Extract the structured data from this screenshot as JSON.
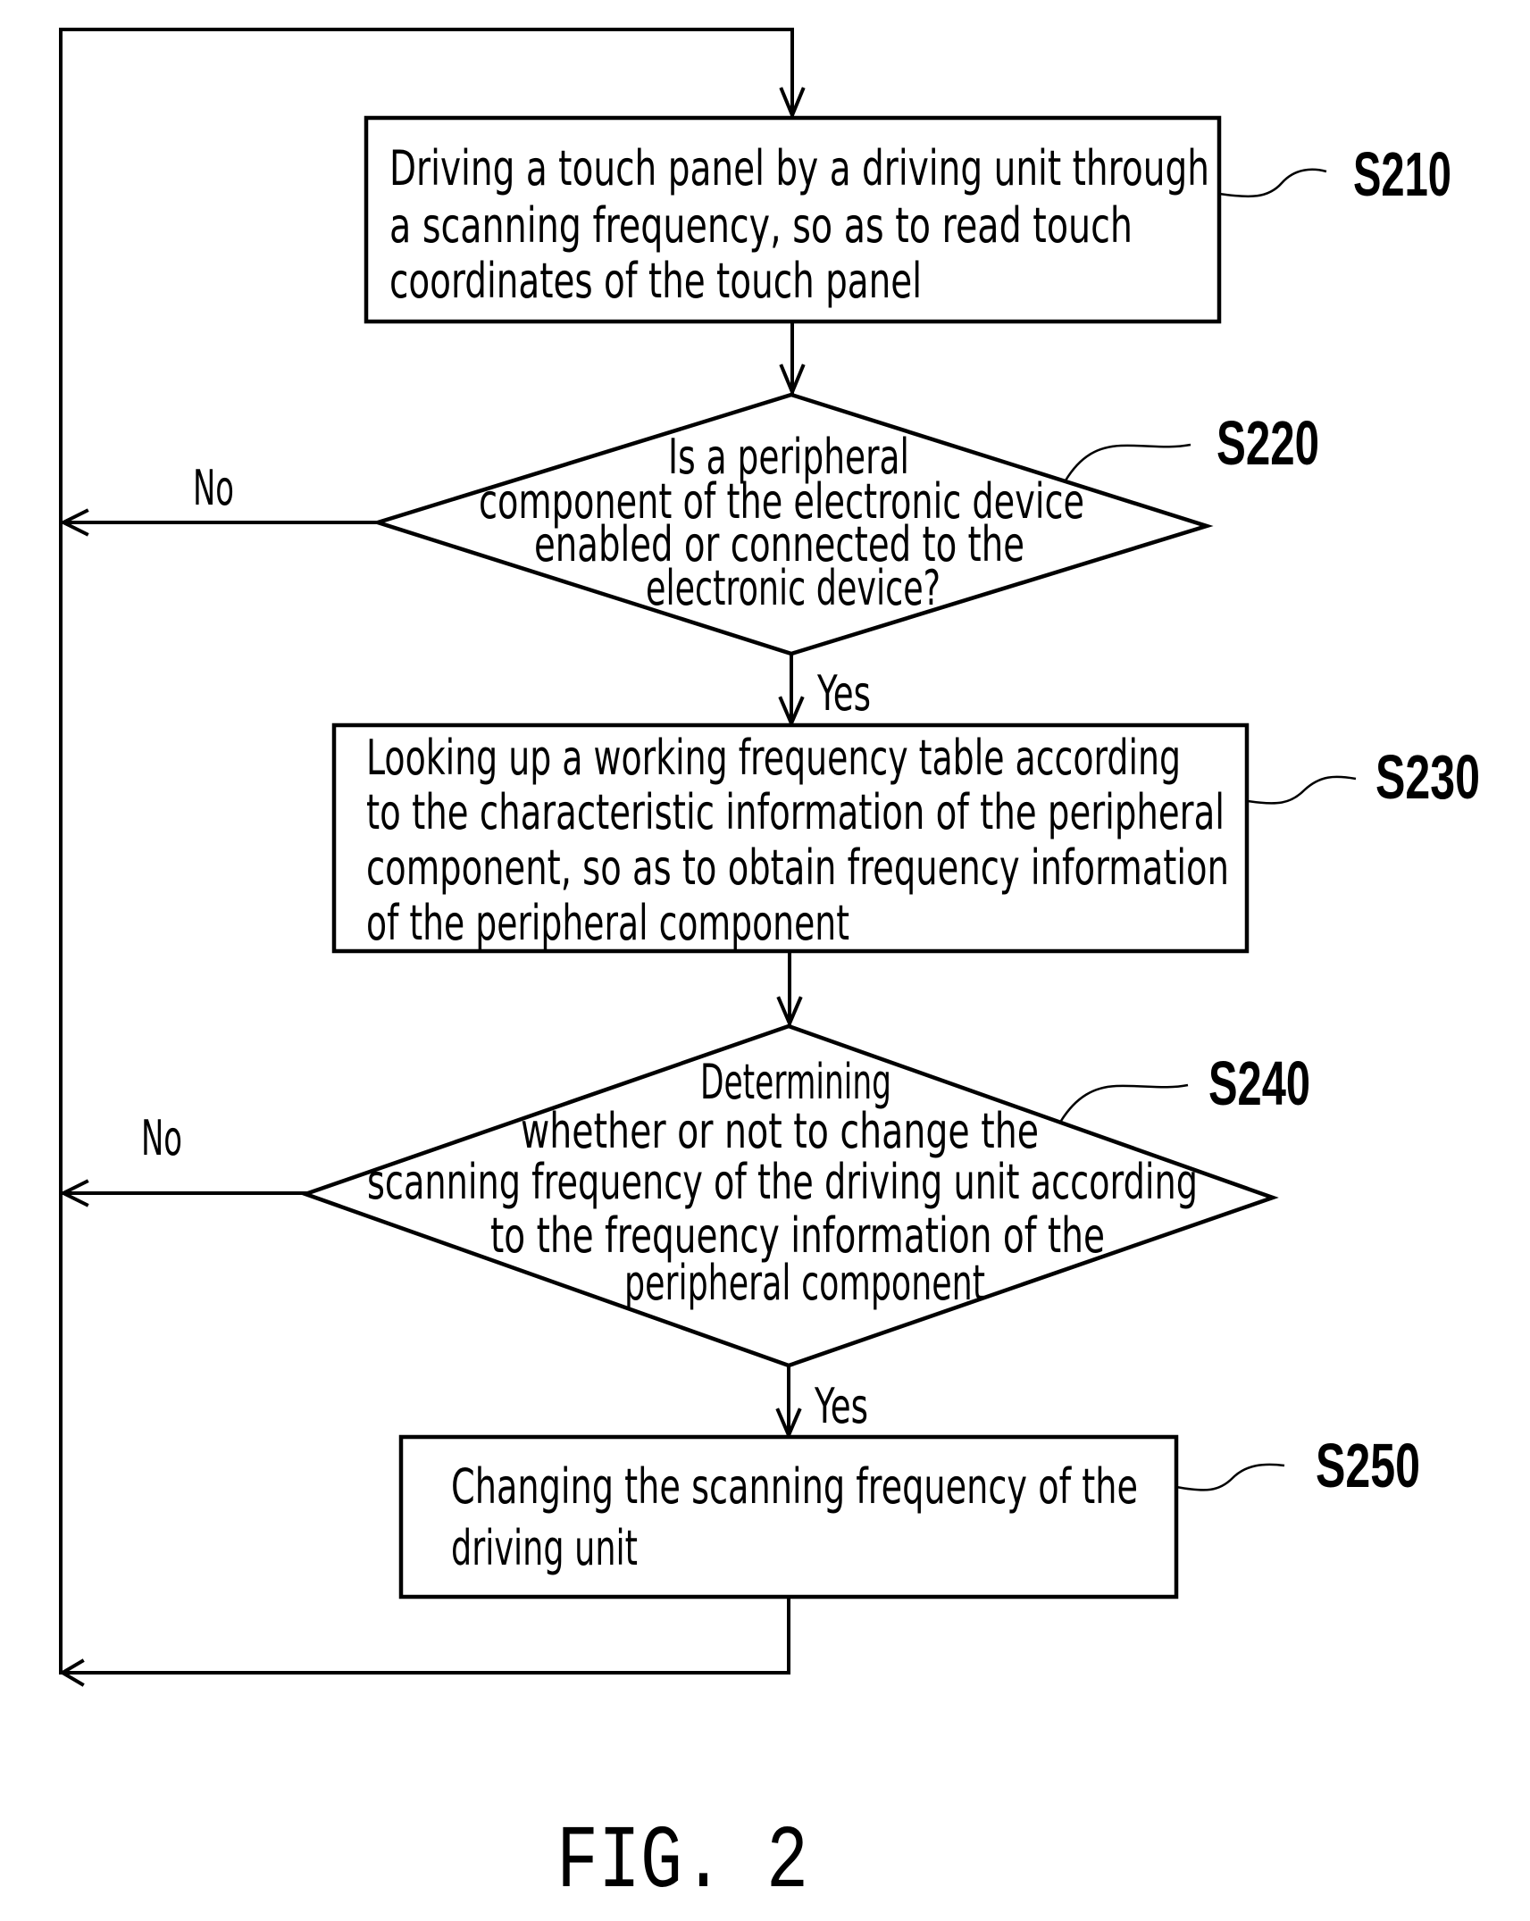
{
  "figure": {
    "caption": "FIG. 2",
    "steps": [
      {
        "id": "S210",
        "type": "process",
        "lines": [
          "Driving a touch panel by a driving unit through",
          "a scanning frequency, so as to read touch",
          "coordinates of the touch panel"
        ]
      },
      {
        "id": "S220",
        "type": "decision",
        "lines": [
          "Is a peripheral",
          "component of the electronic device",
          "enabled or connected to the",
          "electronic device?"
        ],
        "no_label": "No",
        "yes_label": "Yes"
      },
      {
        "id": "S230",
        "type": "process",
        "lines": [
          "Looking up a working frequency table according",
          "to the characteristic information of the peripheral",
          "component, so as to obtain frequency information",
          "of the peripheral component"
        ]
      },
      {
        "id": "S240",
        "type": "decision",
        "lines": [
          "Determining",
          "whether or not to change the",
          "scanning frequency of the driving unit according",
          "to the frequency information of the",
          "peripheral component"
        ],
        "no_label": "No",
        "yes_label": "Yes"
      },
      {
        "id": "S250",
        "type": "process",
        "lines": [
          "Changing the scanning frequency of the",
          "driving unit"
        ]
      }
    ]
  }
}
